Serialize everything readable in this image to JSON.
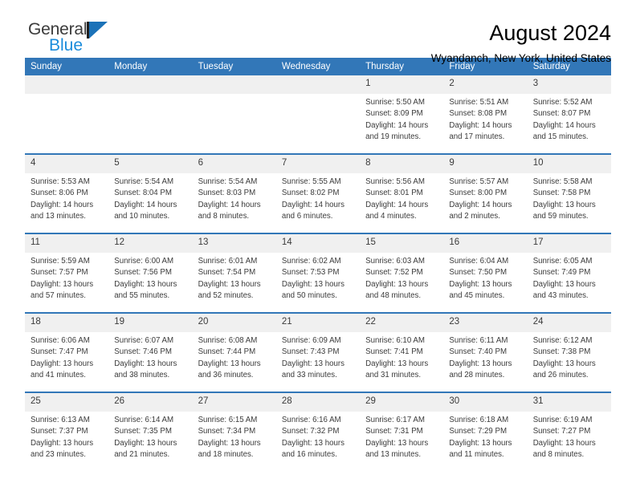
{
  "brand": {
    "name_part1": "General",
    "name_part2": "Blue",
    "flag_icon": "general-blue-flag-icon",
    "accent_color": "#1b8cdb"
  },
  "header": {
    "title": "August 2024",
    "subtitle": "Wyandanch, New York, United States"
  },
  "theme": {
    "header_blue": "#3277b8",
    "daynum_band": "#f0f0f0",
    "text": "#3b3b3b"
  },
  "weekdays": [
    "Sunday",
    "Monday",
    "Tuesday",
    "Wednesday",
    "Thursday",
    "Friday",
    "Saturday"
  ],
  "weeks": [
    [
      {
        "day": "",
        "lines": []
      },
      {
        "day": "",
        "lines": []
      },
      {
        "day": "",
        "lines": []
      },
      {
        "day": "",
        "lines": []
      },
      {
        "day": "1",
        "lines": [
          "Sunrise: 5:50 AM",
          "Sunset: 8:09 PM",
          "Daylight: 14 hours",
          "and 19 minutes."
        ]
      },
      {
        "day": "2",
        "lines": [
          "Sunrise: 5:51 AM",
          "Sunset: 8:08 PM",
          "Daylight: 14 hours",
          "and 17 minutes."
        ]
      },
      {
        "day": "3",
        "lines": [
          "Sunrise: 5:52 AM",
          "Sunset: 8:07 PM",
          "Daylight: 14 hours",
          "and 15 minutes."
        ]
      }
    ],
    [
      {
        "day": "4",
        "lines": [
          "Sunrise: 5:53 AM",
          "Sunset: 8:06 PM",
          "Daylight: 14 hours",
          "and 13 minutes."
        ]
      },
      {
        "day": "5",
        "lines": [
          "Sunrise: 5:54 AM",
          "Sunset: 8:04 PM",
          "Daylight: 14 hours",
          "and 10 minutes."
        ]
      },
      {
        "day": "6",
        "lines": [
          "Sunrise: 5:54 AM",
          "Sunset: 8:03 PM",
          "Daylight: 14 hours",
          "and 8 minutes."
        ]
      },
      {
        "day": "7",
        "lines": [
          "Sunrise: 5:55 AM",
          "Sunset: 8:02 PM",
          "Daylight: 14 hours",
          "and 6 minutes."
        ]
      },
      {
        "day": "8",
        "lines": [
          "Sunrise: 5:56 AM",
          "Sunset: 8:01 PM",
          "Daylight: 14 hours",
          "and 4 minutes."
        ]
      },
      {
        "day": "9",
        "lines": [
          "Sunrise: 5:57 AM",
          "Sunset: 8:00 PM",
          "Daylight: 14 hours",
          "and 2 minutes."
        ]
      },
      {
        "day": "10",
        "lines": [
          "Sunrise: 5:58 AM",
          "Sunset: 7:58 PM",
          "Daylight: 13 hours",
          "and 59 minutes."
        ]
      }
    ],
    [
      {
        "day": "11",
        "lines": [
          "Sunrise: 5:59 AM",
          "Sunset: 7:57 PM",
          "Daylight: 13 hours",
          "and 57 minutes."
        ]
      },
      {
        "day": "12",
        "lines": [
          "Sunrise: 6:00 AM",
          "Sunset: 7:56 PM",
          "Daylight: 13 hours",
          "and 55 minutes."
        ]
      },
      {
        "day": "13",
        "lines": [
          "Sunrise: 6:01 AM",
          "Sunset: 7:54 PM",
          "Daylight: 13 hours",
          "and 52 minutes."
        ]
      },
      {
        "day": "14",
        "lines": [
          "Sunrise: 6:02 AM",
          "Sunset: 7:53 PM",
          "Daylight: 13 hours",
          "and 50 minutes."
        ]
      },
      {
        "day": "15",
        "lines": [
          "Sunrise: 6:03 AM",
          "Sunset: 7:52 PM",
          "Daylight: 13 hours",
          "and 48 minutes."
        ]
      },
      {
        "day": "16",
        "lines": [
          "Sunrise: 6:04 AM",
          "Sunset: 7:50 PM",
          "Daylight: 13 hours",
          "and 45 minutes."
        ]
      },
      {
        "day": "17",
        "lines": [
          "Sunrise: 6:05 AM",
          "Sunset: 7:49 PM",
          "Daylight: 13 hours",
          "and 43 minutes."
        ]
      }
    ],
    [
      {
        "day": "18",
        "lines": [
          "Sunrise: 6:06 AM",
          "Sunset: 7:47 PM",
          "Daylight: 13 hours",
          "and 41 minutes."
        ]
      },
      {
        "day": "19",
        "lines": [
          "Sunrise: 6:07 AM",
          "Sunset: 7:46 PM",
          "Daylight: 13 hours",
          "and 38 minutes."
        ]
      },
      {
        "day": "20",
        "lines": [
          "Sunrise: 6:08 AM",
          "Sunset: 7:44 PM",
          "Daylight: 13 hours",
          "and 36 minutes."
        ]
      },
      {
        "day": "21",
        "lines": [
          "Sunrise: 6:09 AM",
          "Sunset: 7:43 PM",
          "Daylight: 13 hours",
          "and 33 minutes."
        ]
      },
      {
        "day": "22",
        "lines": [
          "Sunrise: 6:10 AM",
          "Sunset: 7:41 PM",
          "Daylight: 13 hours",
          "and 31 minutes."
        ]
      },
      {
        "day": "23",
        "lines": [
          "Sunrise: 6:11 AM",
          "Sunset: 7:40 PM",
          "Daylight: 13 hours",
          "and 28 minutes."
        ]
      },
      {
        "day": "24",
        "lines": [
          "Sunrise: 6:12 AM",
          "Sunset: 7:38 PM",
          "Daylight: 13 hours",
          "and 26 minutes."
        ]
      }
    ],
    [
      {
        "day": "25",
        "lines": [
          "Sunrise: 6:13 AM",
          "Sunset: 7:37 PM",
          "Daylight: 13 hours",
          "and 23 minutes."
        ]
      },
      {
        "day": "26",
        "lines": [
          "Sunrise: 6:14 AM",
          "Sunset: 7:35 PM",
          "Daylight: 13 hours",
          "and 21 minutes."
        ]
      },
      {
        "day": "27",
        "lines": [
          "Sunrise: 6:15 AM",
          "Sunset: 7:34 PM",
          "Daylight: 13 hours",
          "and 18 minutes."
        ]
      },
      {
        "day": "28",
        "lines": [
          "Sunrise: 6:16 AM",
          "Sunset: 7:32 PM",
          "Daylight: 13 hours",
          "and 16 minutes."
        ]
      },
      {
        "day": "29",
        "lines": [
          "Sunrise: 6:17 AM",
          "Sunset: 7:31 PM",
          "Daylight: 13 hours",
          "and 13 minutes."
        ]
      },
      {
        "day": "30",
        "lines": [
          "Sunrise: 6:18 AM",
          "Sunset: 7:29 PM",
          "Daylight: 13 hours",
          "and 11 minutes."
        ]
      },
      {
        "day": "31",
        "lines": [
          "Sunrise: 6:19 AM",
          "Sunset: 7:27 PM",
          "Daylight: 13 hours",
          "and 8 minutes."
        ]
      }
    ]
  ]
}
